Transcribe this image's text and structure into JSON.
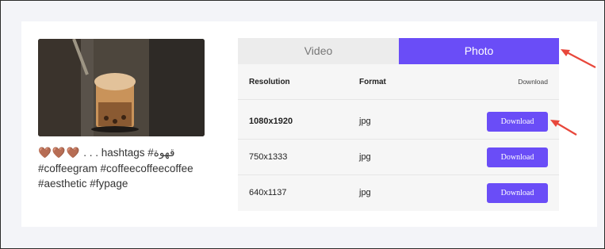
{
  "caption": {
    "hearts": "🤎🤎🤎",
    "line1_rest": " . . . hashtags #قهوة",
    "line2": "#coffeegram #coffeecoffeecoffee",
    "line3": "#aesthetic #fypage"
  },
  "tabs": [
    {
      "label": "Video",
      "active": false
    },
    {
      "label": "Photo",
      "active": true
    }
  ],
  "table": {
    "headers": {
      "resolution": "Resolution",
      "format": "Format",
      "action": "Download"
    },
    "rows": [
      {
        "resolution": "1080x1920",
        "format": "jpg",
        "button": "Download"
      },
      {
        "resolution": "750x1333",
        "format": "jpg",
        "button": "Download"
      },
      {
        "resolution": "640x1137",
        "format": "jpg",
        "button": "Download"
      }
    ]
  },
  "colors": {
    "accent": "#6a4df7",
    "annotation_arrow": "#e8473b"
  },
  "icons": {
    "annotation": "red-arrow-icon",
    "heart": "brown-heart-icon"
  }
}
